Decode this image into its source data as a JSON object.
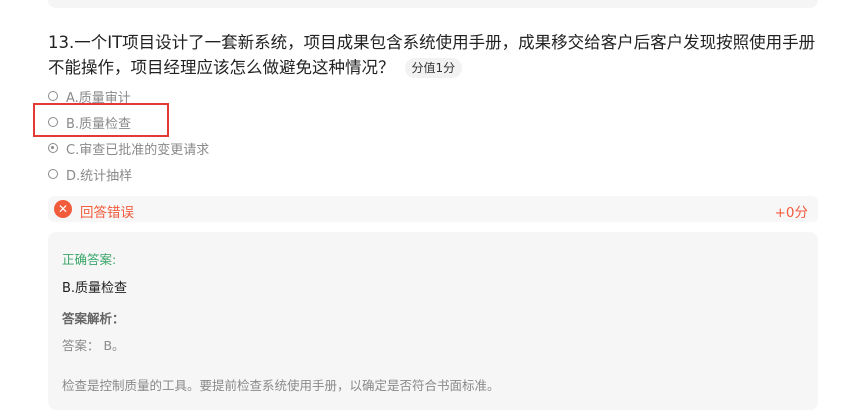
{
  "question": {
    "text": "13.一个IT项目设计了一套新系统，项目成果包含系统使用手册，成果移交给客户后客户发现按照使用手册不能操作，项目经理应该怎么做避免这种情况？",
    "score_badge": "分值1分"
  },
  "options": [
    {
      "label": "A.质量审计",
      "selected": false
    },
    {
      "label": "B.质量检查",
      "selected": false
    },
    {
      "label": "C.审查已批准的变更请求",
      "selected": true
    },
    {
      "label": "D.统计抽样",
      "selected": false
    }
  ],
  "result": {
    "icon": "close-icon",
    "label": "回答错误",
    "score": "+0分"
  },
  "analysis": {
    "correct_title": "正确答案:",
    "correct_answer": "B.质量检查",
    "explanation_title": "答案解析：",
    "explanation_line1": "答案： B。",
    "explanation_line2": "检查是控制质量的工具。要提前检查系统使用手册，以确定是否符合书面标准。"
  },
  "colors": {
    "error": "#f25b3c",
    "correct": "#3aa66a",
    "highlight": "#e53935"
  }
}
